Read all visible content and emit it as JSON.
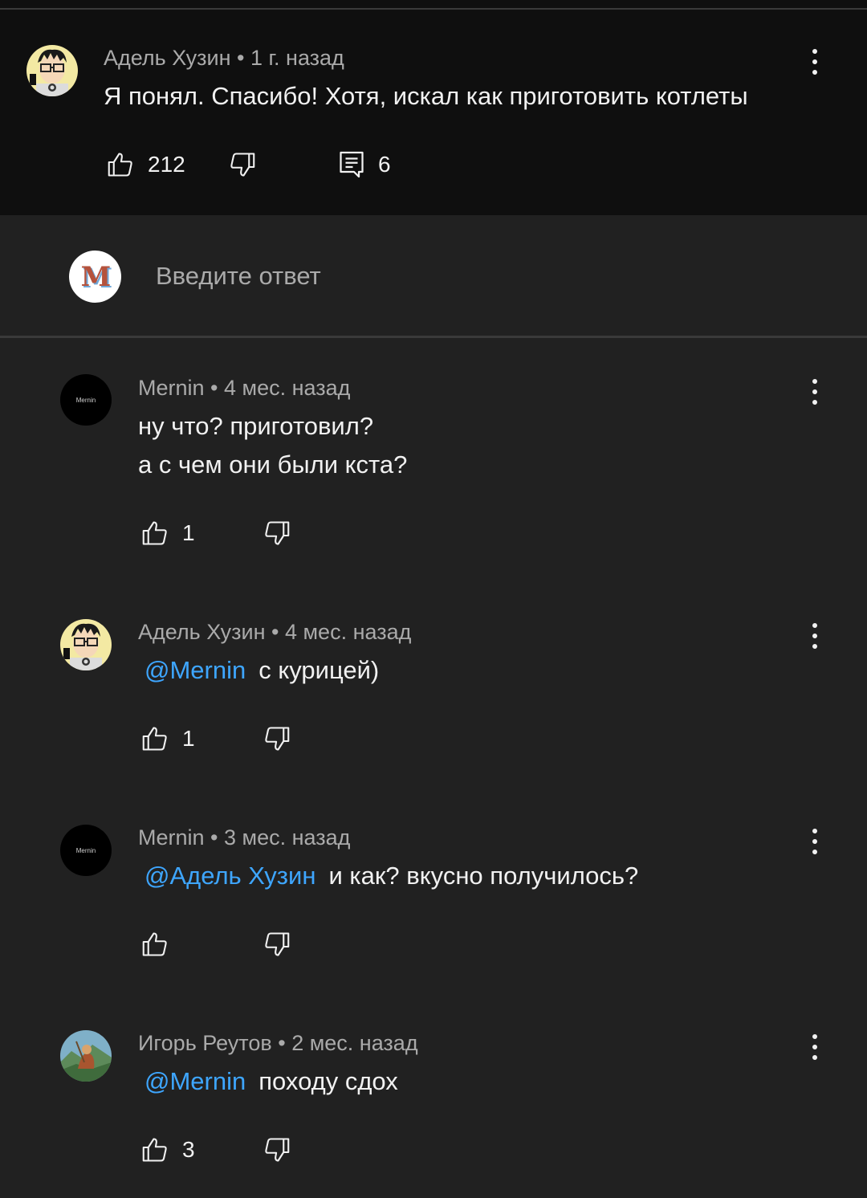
{
  "parent_comment": {
    "author": "Адель Хузин",
    "time": "1 г. назад",
    "text": "Я понял. Спасибо! Хотя, искал как приготовить котлеты",
    "likes": "212",
    "replies": "6"
  },
  "reply_box": {
    "avatar_letter": "M",
    "placeholder": "Введите ответ"
  },
  "replies": [
    {
      "author": "Mernin",
      "time": "4 мес. назад",
      "line1": "ну что? приготовил?",
      "line2": "а с чем они были кста?",
      "likes": "1",
      "avatar_text": "Mernin"
    },
    {
      "author": "Адель Хузин",
      "time": "4 мес. назад",
      "mention": "@Mernin",
      "text": "с курицей)",
      "likes": "1"
    },
    {
      "author": "Mernin",
      "time": "3 мес. назад",
      "mention": "@Адель Хузин",
      "text": "и как? вкусно получилось?",
      "likes": "",
      "avatar_text": "Mernin"
    },
    {
      "author": "Игорь Реутов",
      "time": "2 мес. назад",
      "mention": "@Mernin",
      "text": "походу сдох",
      "likes": "3"
    }
  ],
  "separator": " • ",
  "colors": {
    "background": "#212121",
    "parent_background": "#0f0f0f",
    "mention": "#3ea6ff",
    "meta": "#aaaaaa",
    "text": "#f1f1f1"
  }
}
